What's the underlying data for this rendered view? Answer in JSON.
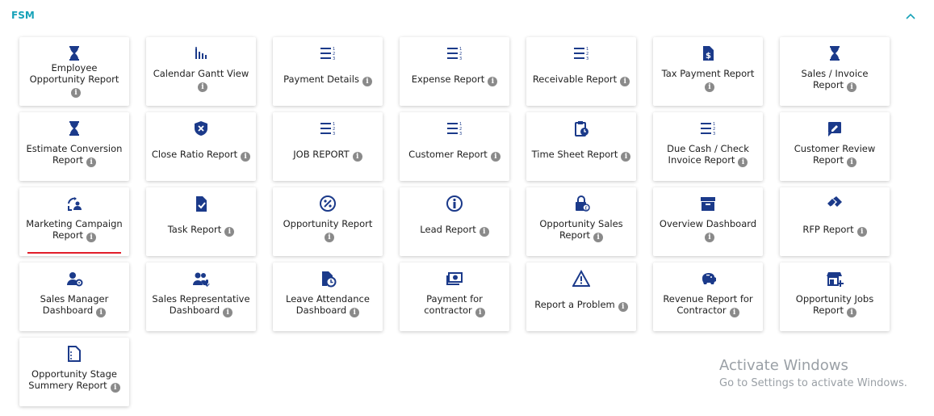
{
  "section": {
    "title": "FSM",
    "accent_color": "#17a2b8"
  },
  "info_glyph": "i",
  "tiles": [
    {
      "icon": "hourglass-icon",
      "label": "Employee Opportunity Report"
    },
    {
      "icon": "bar-chart-icon",
      "label": "Calendar Gantt View"
    },
    {
      "icon": "numbered-list-icon",
      "label": "Payment Details"
    },
    {
      "icon": "numbered-list-icon",
      "label": "Expense Report"
    },
    {
      "icon": "numbered-list-icon",
      "label": "Receivable Report"
    },
    {
      "icon": "dollar-file-icon",
      "label": "Tax Payment Report"
    },
    {
      "icon": "hourglass-icon",
      "label": "Sales / Invoice Report"
    },
    {
      "icon": "hourglass-icon",
      "label": "Estimate Conversion Report"
    },
    {
      "icon": "shield-x-icon",
      "label": "Close Ratio Report"
    },
    {
      "icon": "numbered-list-icon",
      "label": "JOB REPORT"
    },
    {
      "icon": "numbered-list-icon",
      "label": "Customer Report"
    },
    {
      "icon": "clipboard-clock-icon",
      "label": "Time Sheet Report"
    },
    {
      "icon": "numbered-list-icon",
      "label": "Due Cash / Check Invoice Report"
    },
    {
      "icon": "edit-box-icon",
      "label": "Customer Review Report"
    },
    {
      "icon": "campaign-icon",
      "label": "Marketing Campaign Report",
      "selected": true
    },
    {
      "icon": "task-file-icon",
      "label": "Task Report"
    },
    {
      "icon": "percent-circle-icon",
      "label": "Opportunity Report"
    },
    {
      "icon": "info-circle-icon",
      "label": "Lead Report"
    },
    {
      "icon": "lock-coin-icon",
      "label": "Opportunity Sales Report"
    },
    {
      "icon": "archive-box-icon",
      "label": "Overview Dashboard"
    },
    {
      "icon": "handshake-icon",
      "label": "RFP Report"
    },
    {
      "icon": "user-gear-icon",
      "label": "Sales Manager Dashboard"
    },
    {
      "icon": "users-mic-icon",
      "label": "Sales Representative Dashboard"
    },
    {
      "icon": "file-clock-icon",
      "label": "Leave Attendance Dashboard"
    },
    {
      "icon": "cash-icon",
      "label": "Payment for contractor"
    },
    {
      "icon": "warning-triangle-icon",
      "label": "Report a Problem"
    },
    {
      "icon": "piggy-bank-icon",
      "label": "Revenue Report for Contractor"
    },
    {
      "icon": "store-plus-icon",
      "label": "Opportunity Jobs Report"
    },
    {
      "icon": "dotted-file-icon",
      "label": "Opportunity Stage Summery Report"
    }
  ],
  "icon_color": "#1b3a8a",
  "selected_underline_color": "#e11d2a",
  "watermark": {
    "line1": "Activate Windows",
    "line2": "Go to Settings to activate Windows."
  }
}
